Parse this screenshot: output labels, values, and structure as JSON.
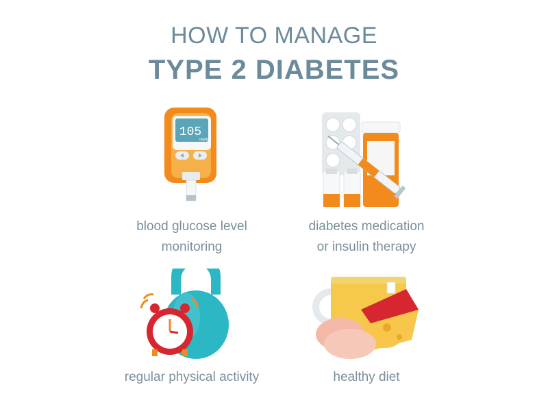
{
  "header": {
    "line1": "HOW TO MANAGE",
    "line2": "TYPE 2 DIABETES"
  },
  "items": [
    {
      "icon": "glucose-meter-icon",
      "label_lines": [
        "blood glucose level",
        "monitoring"
      ],
      "meter_reading": "105",
      "meter_unit": "mg/dL"
    },
    {
      "icon": "medication-icon",
      "label_lines": [
        "diabetes medication",
        "or insulin therapy"
      ]
    },
    {
      "icon": "kettlebell-clock-icon",
      "label_lines": [
        "regular physical activity"
      ]
    },
    {
      "icon": "healthy-food-icon",
      "label_lines": [
        "healthy diet"
      ]
    }
  ],
  "colors": {
    "title": "#6b8a9a",
    "label": "#7a8f9a",
    "orange": "#f28a1c",
    "teal": "#2bb7c4",
    "red": "#d6262f"
  }
}
